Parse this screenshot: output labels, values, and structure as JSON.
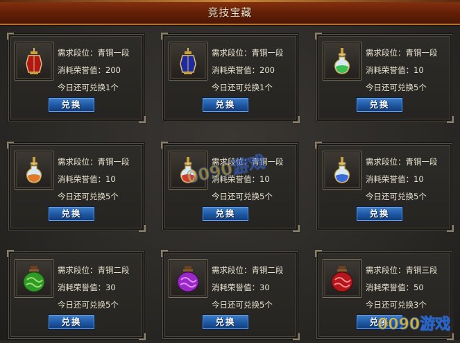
{
  "title": "竞技宝藏",
  "cards": [
    {
      "req": "需求段位：青铜一段",
      "cost": "消耗荣誉值：200",
      "limit": "今日还可兑换1个",
      "btn": "兑换",
      "icon": "red-lantern-icon",
      "color": "#b01818"
    },
    {
      "req": "需求段位：青铜一段",
      "cost": "消耗荣誉值：200",
      "limit": "今日还可兑换1个",
      "btn": "兑换",
      "icon": "blue-lantern-icon",
      "color": "#1e2aa0"
    },
    {
      "req": "需求段位：青铜一段",
      "cost": "消耗荣誉值：10",
      "limit": "今日还可兑换5个",
      "btn": "兑换",
      "icon": "green-potion-icon",
      "color": "#3fbf4f"
    },
    {
      "req": "需求段位：青铜一段",
      "cost": "消耗荣誉值：10",
      "limit": "今日还可兑换5个",
      "btn": "兑换",
      "icon": "orange-potion-icon",
      "color": "#e07a2a"
    },
    {
      "req": "需求段位：青铜一段",
      "cost": "消耗荣誉值：10",
      "limit": "今日还可兑换5个",
      "btn": "兑换",
      "icon": "red-potion-icon",
      "color": "#d23a2a"
    },
    {
      "req": "需求段位：青铜一段",
      "cost": "消耗荣誉值：10",
      "limit": "今日还可兑换5个",
      "btn": "兑换",
      "icon": "blue-potion-icon",
      "color": "#3a6ad8"
    },
    {
      "req": "需求段位：青铜二段",
      "cost": "消耗荣誉值：30",
      "limit": "今日还可兑换5个",
      "btn": "兑换",
      "icon": "green-jar-icon",
      "color": "#2f9a26"
    },
    {
      "req": "需求段位：青铜二段",
      "cost": "消耗荣誉值：30",
      "limit": "今日还可兑换5个",
      "btn": "兑换",
      "icon": "purple-jar-icon",
      "color": "#9a28c4"
    },
    {
      "req": "需求段位：青铜三段",
      "cost": "消耗荣誉值：50",
      "limit": "今日还可兑换3个",
      "btn": "兑换",
      "icon": "red-jar-icon",
      "color": "#b4161c"
    }
  ],
  "watermark": {
    "center": "0090游戏",
    "corner": "0090游戏"
  }
}
